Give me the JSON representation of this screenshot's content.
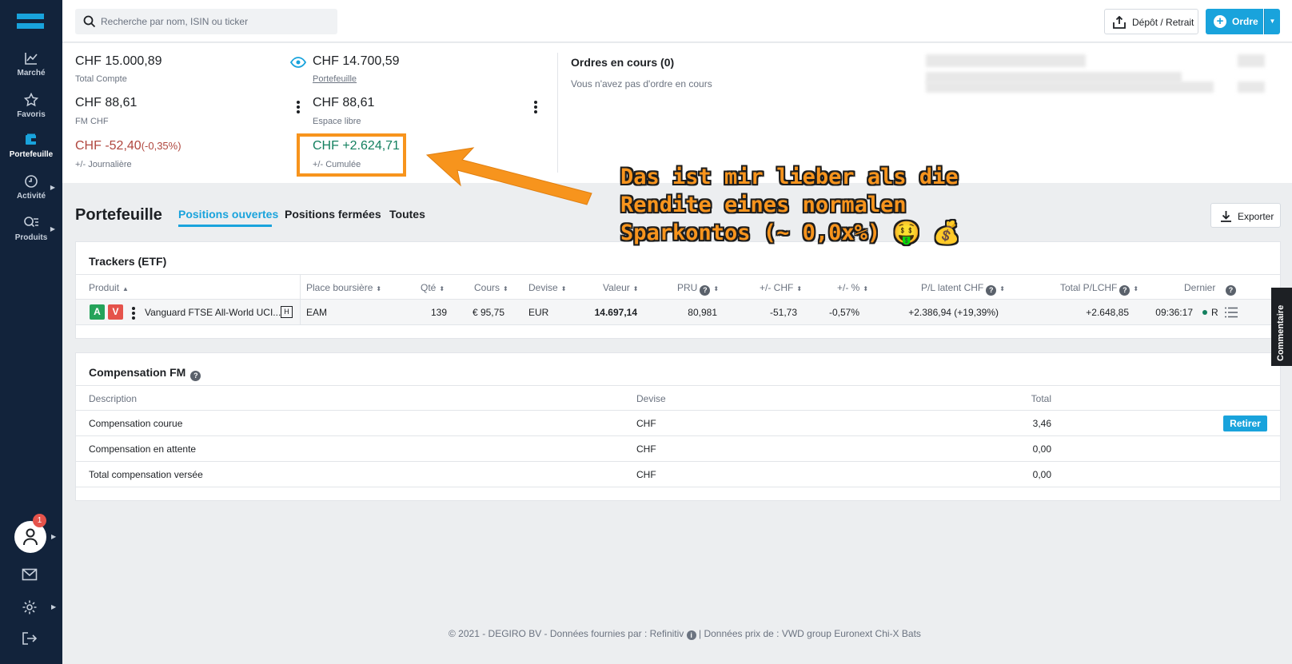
{
  "search": {
    "placeholder": "Recherche par nom, ISIN ou ticker"
  },
  "header": {
    "depot_label": "Dépôt / Retrait",
    "ordre_label": "Ordre"
  },
  "sidebar": {
    "items": [
      {
        "label": "Marché"
      },
      {
        "label": "Favoris"
      },
      {
        "label": "Portefeuille"
      },
      {
        "label": "Activité"
      },
      {
        "label": "Produits"
      }
    ],
    "notification_count": "1"
  },
  "summary": {
    "total_compte_value": "CHF 15.000,89",
    "total_compte_label": "Total Compte",
    "portefeuille_value": "CHF 14.700,59",
    "portefeuille_label": "Portefeuille",
    "fm_value": "CHF 88,61",
    "fm_label": "FM CHF",
    "espace_value": "CHF 88,61",
    "espace_label": "Espace libre",
    "journaliere_value": "CHF -52,40",
    "journaliere_pct": "(-0,35%)",
    "journaliere_label": "+/- Journalière",
    "cumulee_value": "CHF +2.624,71",
    "cumulee_label": "+/- Cumulée",
    "orders_title": "Ordres en cours (0)",
    "orders_empty": "Vous n'avez pas d'ordre en cours"
  },
  "portfolio": {
    "title": "Portefeuille",
    "tabs": [
      {
        "label": "Positions ouvertes"
      },
      {
        "label": "Positions fermées"
      },
      {
        "label": "Toutes"
      }
    ],
    "export_label": "Exporter"
  },
  "trackers": {
    "title": "Trackers (ETF)",
    "columns": [
      "Produit",
      "Place boursière",
      "Qté",
      "Cours",
      "Devise",
      "Valeur",
      "PRU",
      "+/- CHF",
      "+/- %",
      "P/L latent CHF",
      "Total P/LCHF",
      "Dernier"
    ],
    "row": {
      "buy_tag": "A",
      "sell_tag": "V",
      "product": "Vanguard FTSE All-World UCI...",
      "h_tag": "H",
      "exchange": "EAM",
      "qty": "139",
      "price": "€ 95,75",
      "currency": "EUR",
      "value": "14.697,14",
      "pru": "80,981",
      "pl_chf": "-51,73",
      "pl_pct": "-0,57%",
      "pl_latent": "+2.386,94 (+19,39%)",
      "total_pl": "+2.648,85",
      "last": "09:36:17",
      "status": "R"
    }
  },
  "compensation": {
    "title": "Compensation FM",
    "columns": [
      "Description",
      "Devise",
      "Total"
    ],
    "rows": [
      {
        "description": "Compensation courue",
        "currency": "CHF",
        "total": "3,46"
      },
      {
        "description": "Compensation en attente",
        "currency": "CHF",
        "total": "0,00"
      },
      {
        "description": "Total compensation versée",
        "currency": "CHF",
        "total": "0,00"
      }
    ],
    "retirer_label": "Retirer"
  },
  "commentaire_label": "Commentaire",
  "footer": {
    "text_left": "© 2021 - DEGIRO BV - Données fournies par : Refinitiv",
    "info_glyph": "i",
    "text_right": " | Données prix de : VWD group Euronext Chi-X Bats"
  },
  "annotation": {
    "line1": "Das ist mir lieber als die",
    "line2": "Rendite eines normalen",
    "line3": "Sparkontos (~ 0,0x%) 🤑 💰"
  },
  "colors": {
    "accent": "#19a3dc",
    "sidebar": "#12233b",
    "negative": "#b0473f",
    "positive": "#13805f",
    "annotation": "#f7941d"
  }
}
